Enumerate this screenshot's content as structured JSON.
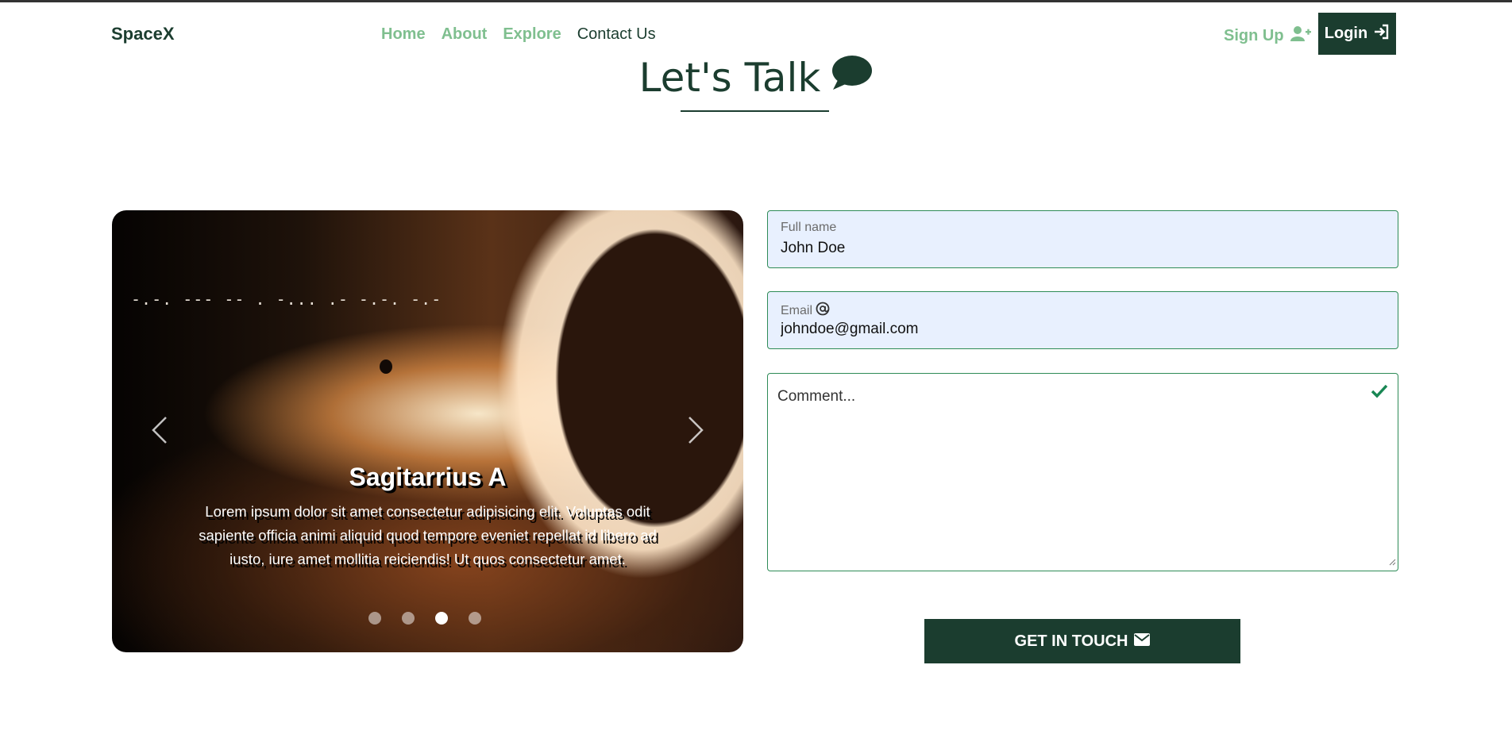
{
  "navbar": {
    "brand": "SpaceX",
    "links": [
      "Home",
      "About",
      "Explore",
      "Contact Us"
    ],
    "active_link": "Contact Us",
    "signup_label": "Sign Up",
    "login_label": "Login"
  },
  "heading": {
    "title": "Let's Talk"
  },
  "carousel": {
    "morse_text": "-.-. --- -- .   -... .- -.-. -.-",
    "slide_title": "Sagitarrius A",
    "slide_text": "Lorem ipsum dolor sit amet consectetur adipisicing elit. Voluptas odit sapiente officia animi aliquid quod tempore eveniet repellat id libero ad iusto, iure amet mollitia reiciendis! Ut quos consectetur amet.",
    "slide_count": 4,
    "active_index": 2
  },
  "form": {
    "full_name_label": "Full name",
    "full_name_value": "John Doe",
    "email_label": "Email",
    "email_value": "johndoe@gmail.com",
    "comment_placeholder": "Comment...",
    "submit_label": "GET IN TOUCH"
  },
  "colors": {
    "primary": "#1b3d2f",
    "nav_link": "#7fbf8f",
    "field_border": "#2e8b57",
    "field_bg": "#e8f0fe"
  },
  "icons": [
    "user-plus-icon",
    "sign-in-icon",
    "comment-icon",
    "at-icon",
    "check-icon",
    "envelope-icon",
    "chevron-left-icon",
    "chevron-right-icon"
  ]
}
